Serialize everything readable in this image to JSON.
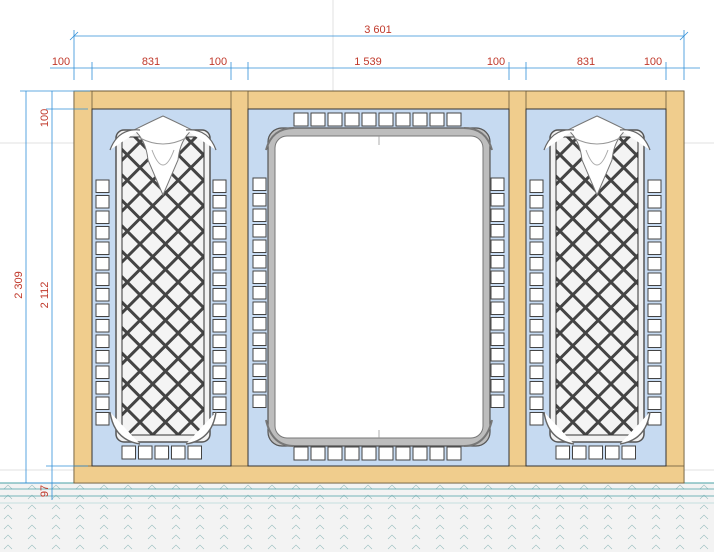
{
  "dimensions": {
    "total_width": "3 601",
    "top_segments": [
      "100",
      "831",
      "100",
      "1 539",
      "100",
      "831",
      "100"
    ],
    "left_total_height": "2 309",
    "left_inner_height": "2 112",
    "left_top_rail": "100",
    "left_base": "97"
  },
  "colors": {
    "frame": "#f0cd8d",
    "panel": "#c6daf1",
    "lattice": "#555555",
    "dimension_line": "#2f8fd8",
    "dimension_text": "#c0392b"
  }
}
